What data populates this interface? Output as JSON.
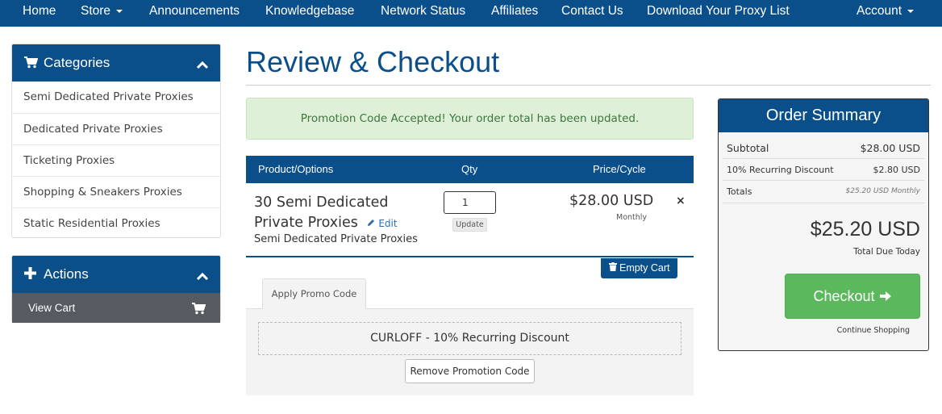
{
  "nav": {
    "home": "Home",
    "store": "Store",
    "announcements": "Announcements",
    "knowledgebase": "Knowledgebase",
    "network_status": "Network Status",
    "affiliates": "Affiliates",
    "contact": "Contact Us",
    "download": "Download Your Proxy List",
    "account": "Account"
  },
  "categories": {
    "title": "Categories",
    "items": [
      "Semi Dedicated Private Proxies",
      "Dedicated Private Proxies",
      "Ticketing Proxies",
      "Shopping & Sneakers Proxies",
      "Static Residential Proxies"
    ]
  },
  "actions": {
    "title": "Actions",
    "view_cart": "View Cart"
  },
  "page": {
    "title": "Review & Checkout",
    "alert": "Promotion Code Accepted! Your order total has been updated."
  },
  "cart": {
    "headers": {
      "product": "Product/Options",
      "qty": "Qty",
      "price": "Price/Cycle"
    },
    "item": {
      "name": "30 Semi Dedicated Private Proxies",
      "edit": "Edit",
      "group": "Semi Dedicated Private Proxies",
      "qty": "1",
      "update": "Update",
      "price": "$28.00 USD",
      "cycle": "Monthly",
      "remove": "×"
    },
    "empty": "Empty Cart"
  },
  "promo": {
    "tab": "Apply Promo Code",
    "applied": "CURLOFF - 10% Recurring Discount",
    "remove": "Remove Promotion Code"
  },
  "summary": {
    "title": "Order Summary",
    "subtotal_label": "Subtotal",
    "subtotal_value": "$28.00 USD",
    "discount_label": "10% Recurring Discount",
    "discount_value": "$2.80 USD",
    "totals_label": "Totals",
    "totals_value": "$25.20 USD Monthly",
    "total": "$25.20 USD",
    "total_label": "Total Due Today",
    "checkout": "Checkout",
    "continue": "Continue Shopping"
  },
  "colors": {
    "primary": "#0b4f8a",
    "success": "#5cb85c",
    "alert_bg": "#dff0d8"
  },
  "icons": [
    "cart-icon",
    "chevron-up-icon",
    "plus-icon",
    "pencil-icon",
    "trash-icon",
    "arrow-right-icon",
    "close-icon"
  ]
}
